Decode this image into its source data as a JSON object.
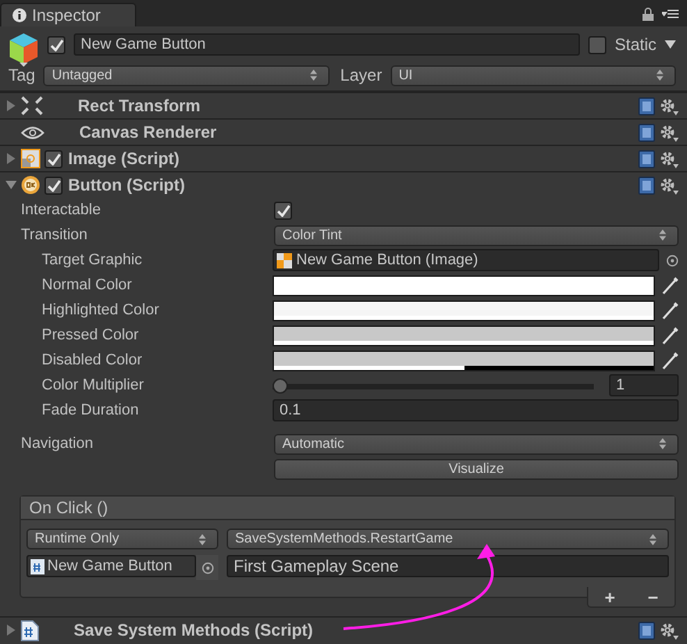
{
  "tab": {
    "label": "Inspector"
  },
  "object": {
    "active": true,
    "name": "New Game Button",
    "static": false,
    "static_label": "Static",
    "tag_label": "Tag",
    "tag": "Untagged",
    "layer_label": "Layer",
    "layer": "UI"
  },
  "components": [
    {
      "kind": "rect-transform",
      "title": "Rect Transform",
      "expanded": false
    },
    {
      "kind": "eye",
      "title": "Canvas Renderer"
    },
    {
      "kind": "image",
      "title": "Image (Script)",
      "expanded": false,
      "enabled": true
    },
    {
      "kind": "button",
      "title": "Button (Script)",
      "expanded": true,
      "enabled": true,
      "property_groups": [
        [
          {
            "kind": "checkbox",
            "label": "Interactable",
            "checked": true
          },
          {
            "kind": "dropdown",
            "label": "Transition",
            "value": "Color Tint",
            "children": [
              {
                "kind": "object",
                "label": "Target Graphic",
                "value": "New Game Button (Image)"
              },
              {
                "kind": "color",
                "label": "Normal Color",
                "color": "#ffffff",
                "level": 1
              },
              {
                "kind": "color",
                "label": "Highlighted Color",
                "color": "#f5f5f5",
                "level": 1
              },
              {
                "kind": "color",
                "label": "Pressed Color",
                "color": "#c8c8c8",
                "level": 1
              },
              {
                "kind": "color",
                "label": "Disabled Color",
                "color": "#c8c8c8",
                "level": 0.5
              },
              {
                "kind": "slider",
                "label": "Color Multiplier",
                "level": 0,
                "value": "1"
              },
              {
                "kind": "number",
                "label": "Fade Duration",
                "value": "0.1"
              }
            ]
          }
        ],
        [
          {
            "kind": "dropdown",
            "label": "Navigation",
            "value": "Automatic"
          },
          {
            "kind": "button",
            "label": "Visualize"
          }
        ]
      ],
      "on_click": {
        "title": "On Click ()",
        "calls": [
          {
            "mode": "Runtime Only",
            "function": "SaveSystemMethods.RestartGame",
            "target": "New Game Button",
            "argument": "First Gameplay Scene"
          }
        ],
        "add": "+",
        "remove": "−"
      }
    },
    {
      "kind": "script",
      "title": "Save System Methods (Script)",
      "expanded": false
    }
  ]
}
